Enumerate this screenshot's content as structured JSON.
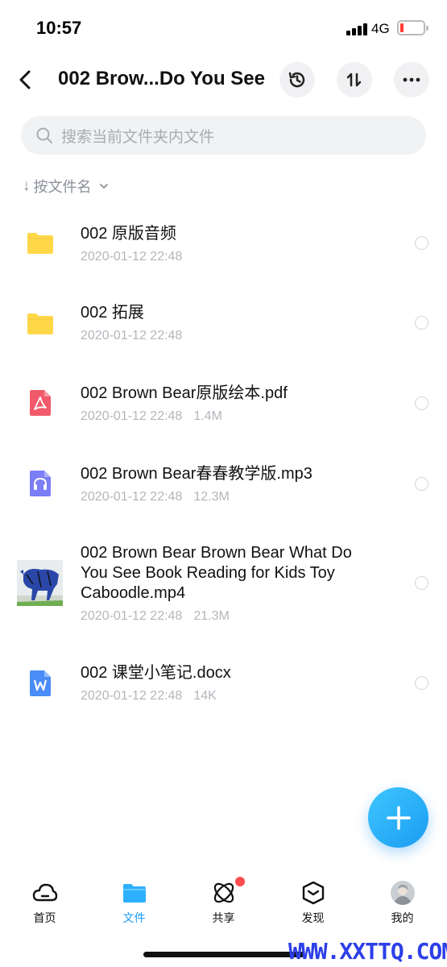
{
  "status": {
    "time": "10:57",
    "network": "4G"
  },
  "header": {
    "title": "002 Brow...Do You See"
  },
  "search": {
    "placeholder": "搜索当前文件夹内文件"
  },
  "sort": {
    "label": "按文件名"
  },
  "files": [
    {
      "name": "002 原版音频",
      "date": "2020-01-12 22:48",
      "size": "",
      "icon": "folder-icon"
    },
    {
      "name": "002 拓展",
      "date": "2020-01-12 22:48",
      "size": "",
      "icon": "folder-icon"
    },
    {
      "name": "002 Brown Bear原版绘本.pdf",
      "date": "2020-01-12 22:48",
      "size": "1.4M",
      "icon": "pdf-icon"
    },
    {
      "name": "002 Brown Bear春春教学版.mp3",
      "date": "2020-01-12 22:48",
      "size": "12.3M",
      "icon": "audio-icon"
    },
    {
      "name": "002 Brown Bear Brown Bear What Do You See Book Reading for Kids Toy Caboodle.mp4",
      "date": "2020-01-12 22:48",
      "size": "21.3M",
      "icon": "video-thumbnail"
    },
    {
      "name": "002 课堂小笔记.docx",
      "date": "2020-01-12 22:48",
      "size": "14K",
      "icon": "word-doc-icon"
    }
  ],
  "tabs": [
    {
      "label": "首页",
      "icon": "cloud-icon"
    },
    {
      "label": "文件",
      "icon": "folder-icon"
    },
    {
      "label": "共享",
      "icon": "atom-share-icon"
    },
    {
      "label": "发现",
      "icon": "discover-box-icon"
    },
    {
      "label": "我的",
      "icon": "avatar"
    }
  ],
  "colors": {
    "accent": "#1a9cf2",
    "folder": "#ffd84a",
    "pdf": "#f05a6a",
    "audio": "#7b7ef5",
    "word": "#4a8cf5",
    "badge": "#ff4d4f"
  },
  "watermark": "WWW.XXTTQ.COM"
}
